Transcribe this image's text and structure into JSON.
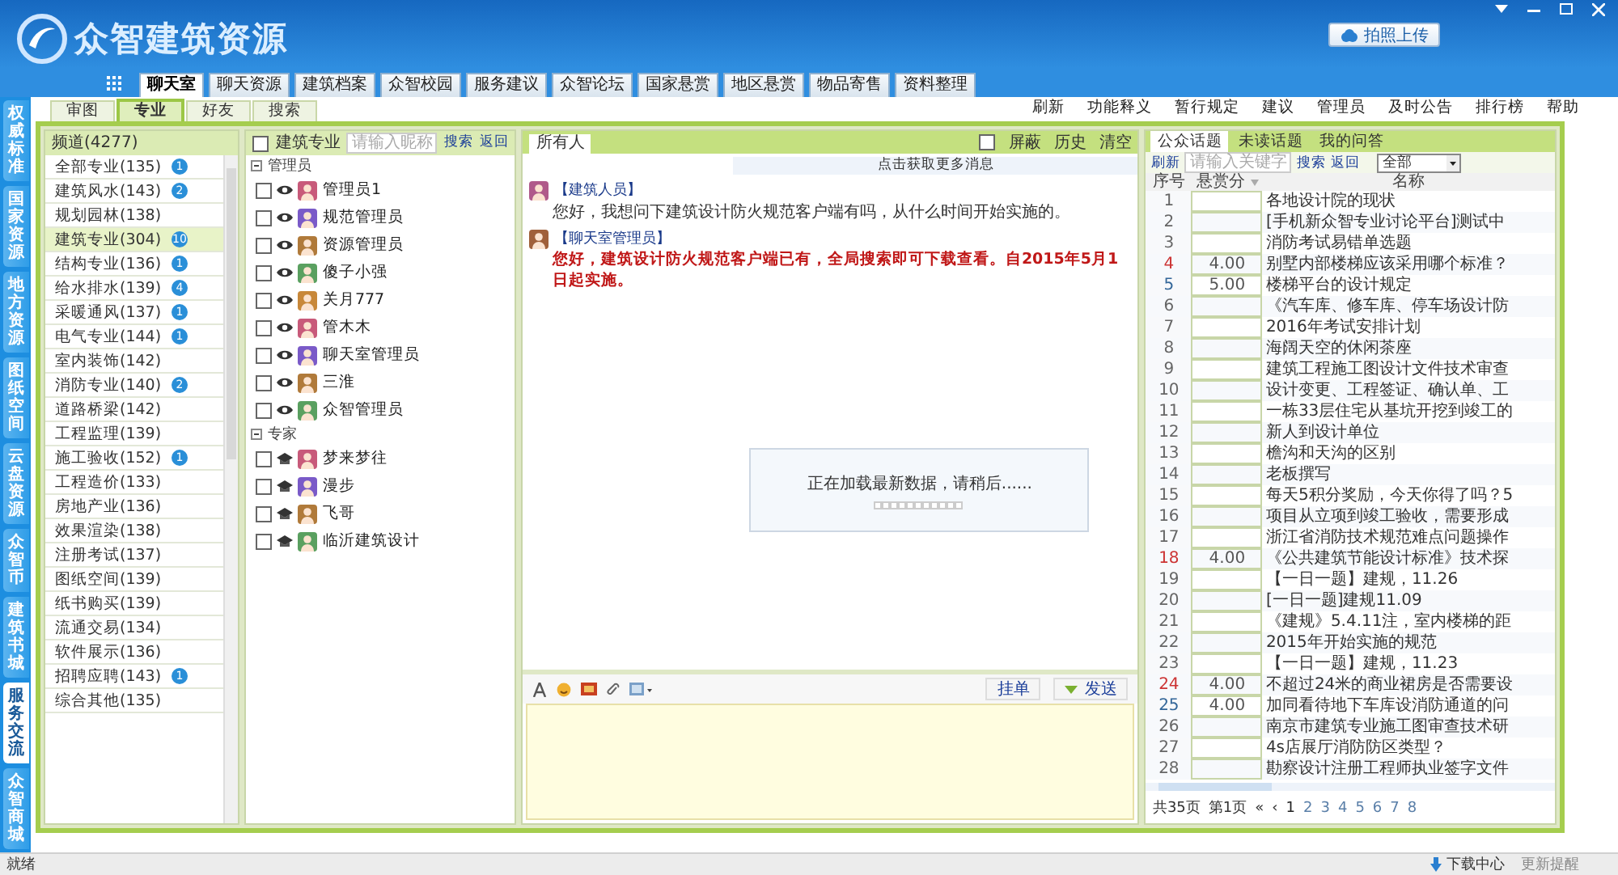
{
  "window": {
    "title": "众智建筑资源",
    "upload_button": "拍照上传"
  },
  "top_tabs": [
    {
      "label": "聊天室",
      "selected": true
    },
    {
      "label": "聊天资源",
      "selected": false
    },
    {
      "label": "建筑档案",
      "selected": false
    },
    {
      "label": "众智校园",
      "selected": false
    },
    {
      "label": "服务建议",
      "selected": false
    },
    {
      "label": "众智论坛",
      "selected": false
    },
    {
      "label": "国家悬赏",
      "selected": false
    },
    {
      "label": "地区悬赏",
      "selected": false
    },
    {
      "label": "物品寄售",
      "selected": false
    },
    {
      "label": "资料整理",
      "selected": false
    }
  ],
  "side_tabs": [
    {
      "label": "权威标准",
      "selected": false
    },
    {
      "label": "国家资源",
      "selected": false
    },
    {
      "label": "地方资源",
      "selected": false
    },
    {
      "label": "图纸空间",
      "selected": false
    },
    {
      "label": "云盘资源",
      "selected": false
    },
    {
      "label": "众智币",
      "selected": false
    },
    {
      "label": "建筑书城",
      "selected": false
    },
    {
      "label": "服务交流",
      "selected": true
    },
    {
      "label": "众智商城",
      "selected": false
    }
  ],
  "sub_tabs": [
    {
      "label": "审图",
      "selected": false
    },
    {
      "label": "专业",
      "selected": true
    },
    {
      "label": "好友",
      "selected": false
    },
    {
      "label": "搜索",
      "selected": false
    }
  ],
  "toolbar_links": [
    "刷新",
    "功能释义",
    "暂行规定",
    "建议",
    "管理员",
    "及时公告",
    "排行榜",
    "帮助"
  ],
  "channels": {
    "header": "频道(4277)",
    "items": [
      {
        "label": "全部专业(135)",
        "badge": "1",
        "selected": false
      },
      {
        "label": "建筑风水(143)",
        "badge": "2",
        "selected": false
      },
      {
        "label": "规划园林(138)",
        "selected": false
      },
      {
        "label": "建筑专业(304)",
        "badge": "10",
        "selected": true
      },
      {
        "label": "结构专业(136)",
        "badge": "1",
        "selected": false
      },
      {
        "label": "给水排水(139)",
        "badge": "4",
        "selected": false
      },
      {
        "label": "采暖通风(137)",
        "badge": "1",
        "selected": false
      },
      {
        "label": "电气专业(144)",
        "badge": "1",
        "selected": false
      },
      {
        "label": "室内装饰(142)",
        "selected": false
      },
      {
        "label": "消防专业(140)",
        "badge": "2",
        "selected": false
      },
      {
        "label": "道路桥梁(142)",
        "selected": false
      },
      {
        "label": "工程监理(139)",
        "selected": false
      },
      {
        "label": "施工验收(152)",
        "badge": "1",
        "selected": false
      },
      {
        "label": "工程造价(133)",
        "selected": false
      },
      {
        "label": "房地产业(136)",
        "selected": false
      },
      {
        "label": "效果渲染(138)",
        "selected": false
      },
      {
        "label": "注册考试(137)",
        "selected": false
      },
      {
        "label": "图纸空间(139)",
        "selected": false
      },
      {
        "label": "纸书购买(139)",
        "selected": false
      },
      {
        "label": "流通交易(134)",
        "selected": false
      },
      {
        "label": "软件展示(136)",
        "selected": false
      },
      {
        "label": "招聘应聘(143)",
        "badge": "1",
        "selected": false
      },
      {
        "label": "综合其他(135)",
        "selected": false
      }
    ]
  },
  "members": {
    "filter_label": "建筑专业",
    "filter_checked": false,
    "search_placeholder": "请输入昵称",
    "search": "搜索",
    "back": "返回",
    "groups": [
      {
        "label": "管理员",
        "kind": "admin",
        "expanded": true,
        "members": [
          {
            "name": "管理员1",
            "checked": false
          },
          {
            "name": "规范管理员",
            "checked": false
          },
          {
            "name": "资源管理员",
            "checked": false
          },
          {
            "name": "傻子小强",
            "checked": false
          },
          {
            "name": "关月777",
            "checked": false
          },
          {
            "name": "管木木",
            "checked": false
          },
          {
            "name": "聊天室管理员",
            "checked": false
          },
          {
            "name": "三淮",
            "checked": false
          },
          {
            "name": "众智管理员",
            "checked": false
          }
        ]
      },
      {
        "label": "专家",
        "kind": "expert",
        "expanded": true,
        "members": [
          {
            "name": "梦来梦往",
            "checked": false
          },
          {
            "name": "漫步",
            "checked": false
          },
          {
            "name": "飞哥",
            "checked": false
          },
          {
            "name": "临沂建筑设计",
            "checked": false
          }
        ]
      }
    ]
  },
  "chat": {
    "tab": "所有人",
    "block_label": "屏蔽",
    "block_checked": false,
    "history": "历史",
    "clear": "清空",
    "more": "点击获取更多消息",
    "messages": [
      {
        "kind": "user",
        "sender": "【建筑人员】",
        "text": "您好，我想问下建筑设计防火规范客户端有吗，从什么时间开始实施的。"
      },
      {
        "kind": "admin",
        "sender": "【聊天室管理员】",
        "text": "您好，建筑设计防火规范客户端已有，全局搜索即可下载查看。自2015年5月1日起实施。"
      }
    ],
    "loading": "正在加载最新数据，请稍后......",
    "hang_button": "挂单",
    "send_button": "发送"
  },
  "topics": {
    "tabs": [
      {
        "label": "公众话题",
        "selected": true
      },
      {
        "label": "未读话题",
        "selected": false
      },
      {
        "label": "我的问答",
        "selected": false
      }
    ],
    "refresh": "刷新",
    "search_placeholder": "请输入关键字",
    "search": "搜索",
    "back": "返回",
    "filter": "全部",
    "columns": [
      "序号",
      "悬赏分",
      "名称"
    ],
    "rows": [
      {
        "no": "1",
        "title": "各地设计院的现状",
        "color": "#666666"
      },
      {
        "no": "2",
        "title": "[手机新众智专业讨论平台]测试中",
        "color": "#666666"
      },
      {
        "no": "3",
        "title": "消防考试易错单选题",
        "color": "#666666"
      },
      {
        "no": "4",
        "points": "4.00",
        "title": "别墅内部楼梯应该采用哪个标准？",
        "color": "#cc3333"
      },
      {
        "no": "5",
        "points": "5.00",
        "title": "楼梯平台的设计规定",
        "color": "#336699"
      },
      {
        "no": "6",
        "title": "《汽车库、修车库、停车场设计防",
        "color": "#666666"
      },
      {
        "no": "7",
        "title": "2016年考试安排计划",
        "color": "#666666"
      },
      {
        "no": "8",
        "title": "海阔天空的休闲茶座",
        "color": "#666666"
      },
      {
        "no": "9",
        "title": "建筑工程施工图设计文件技术审查",
        "color": "#666666"
      },
      {
        "no": "10",
        "title": "设计变更、工程签证、确认单、工",
        "color": "#666666"
      },
      {
        "no": "11",
        "title": "一栋33层住宅从基坑开挖到竣工的",
        "color": "#666666"
      },
      {
        "no": "12",
        "title": "新人到设计单位",
        "color": "#666666"
      },
      {
        "no": "13",
        "title": "檐沟和天沟的区别",
        "color": "#666666"
      },
      {
        "no": "14",
        "title": "老板撰写",
        "color": "#666666"
      },
      {
        "no": "15",
        "title": "每天5积分奖励，今天你得了吗？5",
        "color": "#666666"
      },
      {
        "no": "16",
        "title": "项目从立项到竣工验收，需要形成",
        "color": "#666666"
      },
      {
        "no": "17",
        "title": "浙江省消防技术规范难点问题操作",
        "color": "#666666"
      },
      {
        "no": "18",
        "points": "4.00",
        "title": "《公共建筑节能设计标准》技术探",
        "color": "#cc3333"
      },
      {
        "no": "19",
        "title": "【一日一题】建规，11.26",
        "color": "#666666"
      },
      {
        "no": "20",
        "title": "[一日一题]建规11.09",
        "color": "#666666"
      },
      {
        "no": "21",
        "title": "《建规》5.4.11注，室内楼梯的距",
        "color": "#666666"
      },
      {
        "no": "22",
        "title": "2015年开始实施的规范",
        "color": "#666666"
      },
      {
        "no": "23",
        "title": "【一日一题】建规，11.23",
        "color": "#666666"
      },
      {
        "no": "24",
        "points": "4.00",
        "title": "不超过24米的商业裙房是否需要设",
        "color": "#cc3333"
      },
      {
        "no": "25",
        "points": "4.00",
        "title": "加同看待地下车库设消防通道的问",
        "color": "#336699"
      },
      {
        "no": "26",
        "title": "南京市建筑专业施工图审查技术研",
        "color": "#666666"
      },
      {
        "no": "27",
        "title": "4s店展厅消防防区类型？",
        "color": "#666666"
      },
      {
        "no": "28",
        "title": "勘察设计注册工程师执业签字文件",
        "color": "#666666"
      }
    ],
    "pager": {
      "total": "共35页",
      "current": "第1页",
      "first": "«",
      "prev": "‹",
      "pages": [
        {
          "label": "1",
          "selected": true
        },
        {
          "label": "2",
          "selected": false
        },
        {
          "label": "3",
          "selected": false
        },
        {
          "label": "4",
          "selected": false
        },
        {
          "label": "5",
          "selected": false
        },
        {
          "label": "6",
          "selected": false
        },
        {
          "label": "7",
          "selected": false
        },
        {
          "label": "8",
          "selected": false
        }
      ]
    }
  },
  "status_bar": {
    "text": "就绪",
    "download": "下载中心",
    "update": "更新提醒"
  }
}
